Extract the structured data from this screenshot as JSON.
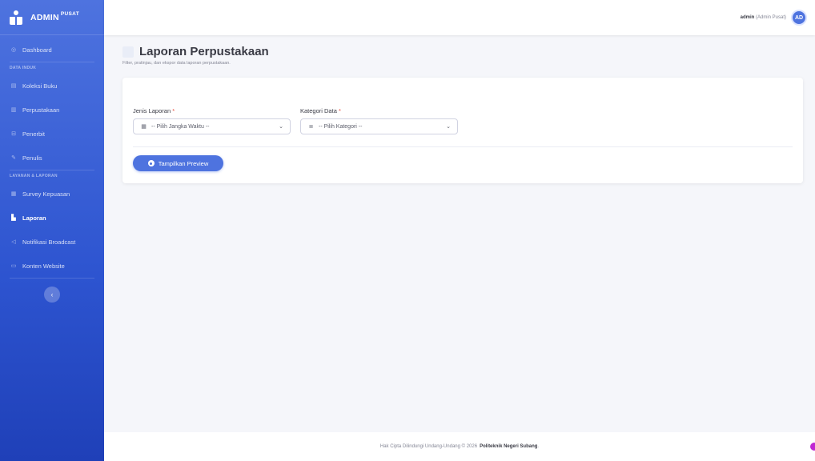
{
  "brand": {
    "name": "ADMIN",
    "sup": "PUSAT"
  },
  "sidebar": {
    "items": [
      {
        "label": "Dashboard"
      },
      {
        "section": "DATA INDUK"
      },
      {
        "label": "Koleksi Buku"
      },
      {
        "label": "Perpustakaan"
      },
      {
        "label": "Penerbit"
      },
      {
        "label": "Penulis"
      },
      {
        "section": "LAYANAN & LAPORAN"
      },
      {
        "label": "Survey Kepuasan"
      },
      {
        "label": "Laporan"
      },
      {
        "label": "Notifikasi Broadcast"
      },
      {
        "label": "Konten Website"
      }
    ],
    "collapse_icon": "‹"
  },
  "topbar": {
    "user": "admin",
    "role": "(Admin Pusat)",
    "avatar": "AD"
  },
  "page": {
    "title": "Laporan Perpustakaan",
    "subtitle": "Filter, pratinjau, dan ekspor data laporan perpustakaan."
  },
  "form": {
    "jenis_label": "Jenis Laporan",
    "jenis_value": "-- Pilih Jangka Waktu --",
    "kategori_label": "Kategori Data",
    "kategori_value": "-- Pilih Kategori --",
    "required_mark": "*",
    "preview_button": "Tampilkan Preview"
  },
  "footer": {
    "text": "Hak Cipta Dilindungi Undang-Undang © 2026",
    "org": "Politeknik Negeri Subang",
    "end": "."
  },
  "colors": {
    "primary": "#4e73df",
    "required": "#e74a3b"
  }
}
